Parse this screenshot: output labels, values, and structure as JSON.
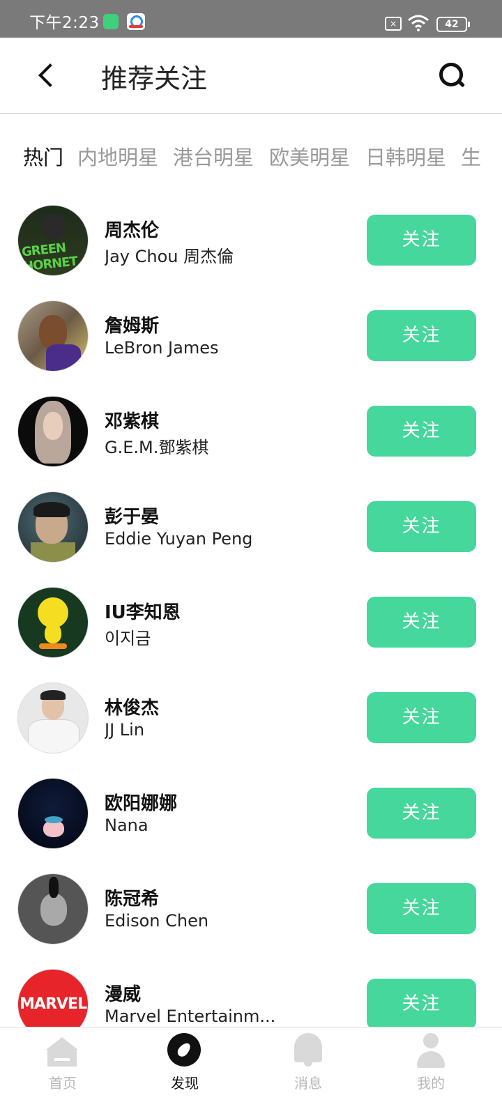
{
  "status_bar": {
    "time": "下午2:23",
    "battery": "42",
    "sim_icon": "no-sim-icon",
    "wifi_icon": "wifi-icon"
  },
  "header": {
    "title": "推荐关注"
  },
  "tabs": [
    {
      "label": "热门",
      "active": true
    },
    {
      "label": "内地明星",
      "active": false
    },
    {
      "label": "港台明星",
      "active": false
    },
    {
      "label": "欧美明星",
      "active": false
    },
    {
      "label": "日韩明星",
      "active": false
    },
    {
      "label": "生",
      "active": false
    }
  ],
  "colors": {
    "accent": "#45d79b",
    "active_text": "#111111",
    "inactive_text": "#999999"
  },
  "list": [
    {
      "name": "周杰伦",
      "sub": "Jay Chou 周杰倫",
      "button": "关注",
      "avatar_text": "GREEN HORNET"
    },
    {
      "name": "詹姆斯",
      "sub": "LeBron James",
      "button": "关注"
    },
    {
      "name": "邓紫棋",
      "sub": "G.E.M.鄧紫棋",
      "button": "关注"
    },
    {
      "name": "彭于晏",
      "sub": "Eddie Yuyan Peng",
      "button": "关注"
    },
    {
      "name": "IU李知恩",
      "sub": "이지금",
      "button": "关注"
    },
    {
      "name": "林俊杰",
      "sub": "JJ Lin",
      "button": "关注"
    },
    {
      "name": "欧阳娜娜",
      "sub": "Nana",
      "button": "关注"
    },
    {
      "name": "陈冠希",
      "sub": "Edison Chen",
      "button": "关注"
    },
    {
      "name": "漫威",
      "sub": "Marvel Entertainm...",
      "button": "关注",
      "avatar_text": "MARVEL"
    }
  ],
  "bottom_nav": [
    {
      "label": "首页",
      "icon": "home-icon",
      "active": false
    },
    {
      "label": "发现",
      "icon": "compass-icon",
      "active": true
    },
    {
      "label": "消息",
      "icon": "bell-icon",
      "active": false
    },
    {
      "label": "我的",
      "icon": "user-icon",
      "active": false
    }
  ]
}
